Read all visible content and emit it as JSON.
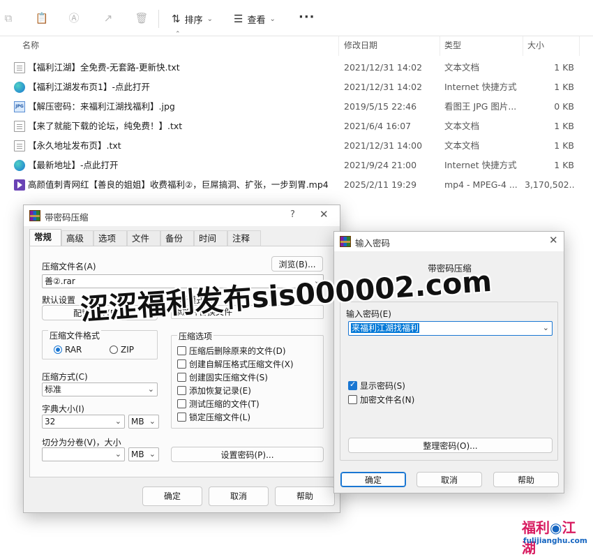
{
  "toolbar": {
    "sort_label": "排序",
    "view_label": "查看",
    "more_label": "···"
  },
  "columns": {
    "name": "名称",
    "date": "修改日期",
    "type": "类型",
    "size": "大小"
  },
  "files": [
    {
      "icon": "text-file-icon",
      "name": "【福利江湖】全免费-无套路-更新快.txt",
      "date": "2021/12/31 14:02",
      "type": "文本文档",
      "size": "1 KB"
    },
    {
      "icon": "internet-shortcut-icon",
      "name": "【福利江湖发布页1】-点此打开",
      "date": "2021/12/31 14:02",
      "type": "Internet 快捷方式",
      "size": "1 KB"
    },
    {
      "icon": "jpg-file-icon",
      "name": "【解压密码：来福利江湖找福利】.jpg",
      "date": "2019/5/15 22:46",
      "type": "看图王 JPG 图片...",
      "size": "0 KB"
    },
    {
      "icon": "text-file-icon",
      "name": "【来了就能下载的论坛，纯免费！】.txt",
      "date": "2021/6/4 16:07",
      "type": "文本文档",
      "size": "1 KB"
    },
    {
      "icon": "text-file-icon",
      "name": "【永久地址发布页】.txt",
      "date": "2021/12/31 14:00",
      "type": "文本文档",
      "size": "1 KB"
    },
    {
      "icon": "internet-shortcut-icon",
      "name": "【最新地址】-点此打开",
      "date": "2021/9/24 21:00",
      "type": "Internet 快捷方式",
      "size": "1 KB"
    },
    {
      "icon": "mp4-file-icon",
      "name": "高颜值刺青网红【善良的姐姐】收费福利②，巨屌搞洞、扩张，一步到胃.mp4",
      "date": "2025/2/11 19:29",
      "type": "mp4 - MPEG-4 ...",
      "size": "3,170,502..."
    }
  ],
  "archive_dialog": {
    "title": "带密码压缩",
    "help_glyph": "?",
    "close_glyph": "✕",
    "tabs": [
      "常规",
      "高级",
      "选项",
      "文件",
      "备份",
      "时间",
      "注释"
    ],
    "archive_name_label": "压缩文件名(A)",
    "browse_button": "浏览(B)...",
    "archive_name_value": "善②.rar",
    "default_settings_label": "默认设置",
    "profiles_button": "配置文件(F)...",
    "update_mode_label": "更新模式(U)",
    "update_mode_value": "添加并替换文件",
    "format_group_label": "压缩文件格式",
    "format_rar": "RAR",
    "format_zip": "ZIP",
    "options_group_label": "压缩选项",
    "options": [
      {
        "label": "压缩后删除原来的文件(D)",
        "checked": false
      },
      {
        "label": "创建自解压格式压缩文件(X)",
        "checked": false
      },
      {
        "label": "创建固实压缩文件(S)",
        "checked": false
      },
      {
        "label": "添加恢复记录(E)",
        "checked": false
      },
      {
        "label": "测试压缩的文件(T)",
        "checked": false
      },
      {
        "label": "锁定压缩文件(L)",
        "checked": false
      }
    ],
    "method_label": "压缩方式(C)",
    "method_value": "标准",
    "dict_label": "字典大小(I)",
    "dict_value": "32",
    "dict_unit": "MB",
    "split_label": "切分为分卷(V)，大小",
    "split_value": "",
    "split_unit": "MB",
    "set_password_button": "设置密码(P)...",
    "ok_button": "确定",
    "cancel_button": "取消",
    "help_button": "帮助"
  },
  "password_dialog": {
    "title": "输入密码",
    "close_glyph": "✕",
    "subtitle": "带密码压缩",
    "password_label": "输入密码(E)",
    "password_value": "来福利江湖找福利",
    "show_password_label": "显示密码(S)",
    "show_password_checked": true,
    "encrypt_names_label": "加密文件名(N)",
    "encrypt_names_checked": false,
    "organize_button": "整理密码(O)...",
    "ok_button": "确定",
    "cancel_button": "取消",
    "help_button": "帮助"
  },
  "watermark": {
    "text": "涩涩福利发布sis000002.com",
    "logo_text_left": "福利",
    "logo_text_right": "江湖",
    "logo_url": "fulijianghu.com"
  },
  "colors": {
    "accent": "#1976d2",
    "selection": "#0078d7",
    "logo_pink": "#d81b60",
    "logo_blue": "#1565c0"
  }
}
